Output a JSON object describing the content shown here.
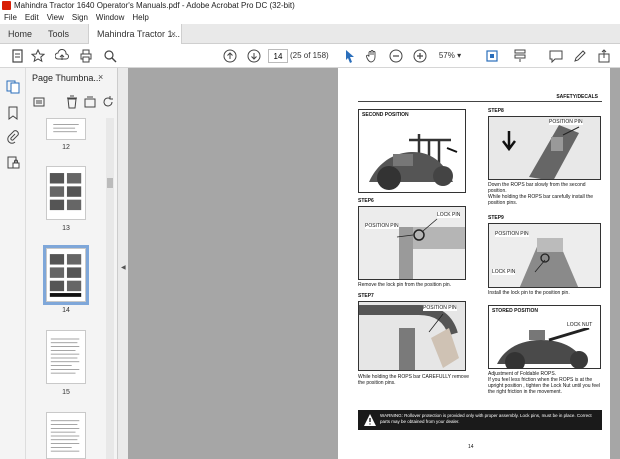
{
  "window": {
    "title": "Mahindra Tractor 1640 Operator's Manuals.pdf - Adobe Acrobat Pro DC (32-bit)"
  },
  "menu": [
    "File",
    "Edit",
    "View",
    "Sign",
    "Window",
    "Help"
  ],
  "tabs": {
    "home": "Home",
    "tools": "Tools",
    "document": "Mahindra Tractor 1...",
    "close": "×"
  },
  "toolbar": {
    "page_value": "14",
    "page_count": "(25 of 158)",
    "zoom": "57%",
    "icons": [
      "create-icon",
      "bookmark-star-icon",
      "upload-icon",
      "print-icon",
      "search-zoom-icon",
      "page-up-icon",
      "page-down-icon",
      "select-arrow-icon",
      "hand-icon",
      "zoom-out-icon",
      "zoom-in-icon",
      "fit-page-icon",
      "scroll-mode-icon",
      "comment-icon",
      "pen-icon",
      "share-icon"
    ]
  },
  "panel": {
    "title": "Page Thumbna...",
    "close": "×",
    "thumb_labels": [
      "12",
      "13",
      "14",
      "15"
    ],
    "selected": "14"
  },
  "page": {
    "header": "SAFETY/DECALS",
    "fig_second_position": "SECOND POSITION",
    "step8": "STEP8",
    "step8_text": "Down the ROPS bar slowly from the second position.\nWhile holding the ROPS bar carefully install the position pins.",
    "position_pin": "POSITION PIN",
    "step6": "STEP6",
    "lock_pin": "LOCK PIN",
    "step6_text": "Remove the lock pin from the position pin.",
    "step9": "STEP9",
    "step9_text": "Install the lock pin to the position pin.",
    "step7": "STEP7",
    "step7_text": "While holding the ROPS bar CAREFULLY remove the position pins.",
    "stored_position": "STORED POSITION",
    "lock_nut": "LOCK NUT",
    "stored_text": "Adjustment of Foldable ROPS.\nIf you feel less friction when the ROPS is at the upright position , tighten the Lock Nut until you feel the right friction in the movement.",
    "warning": "WARNING: Rollover protection is provided only with proper assembly. Lock pins, must be in place. Correct parts may be obtained from your dealer.",
    "page_number": "14"
  }
}
